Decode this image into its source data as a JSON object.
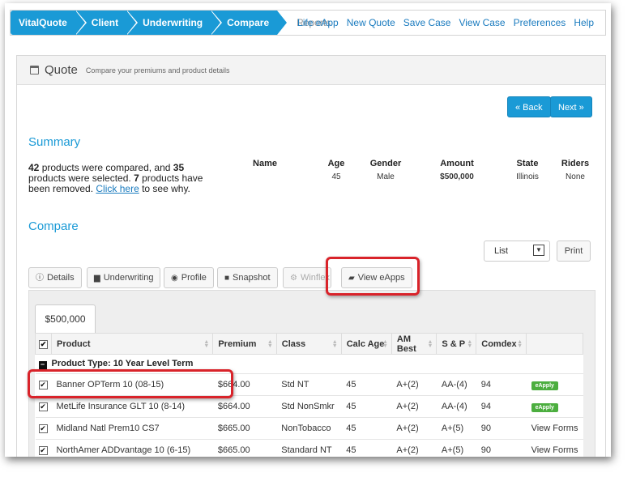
{
  "nav": {
    "crumbs": [
      "VitalQuote",
      "Client",
      "Underwriting",
      "Compare",
      "Reports"
    ],
    "menu": [
      "Life eApp",
      "New Quote",
      "Save Case",
      "View Case",
      "Preferences",
      "Help"
    ]
  },
  "quote": {
    "title": "Quote",
    "subtitle": "Compare your premiums and product details",
    "back_label": "« Back",
    "next_label": "Next »"
  },
  "summary": {
    "heading": "Summary",
    "compared": "42",
    "selected": "35",
    "removed": "7",
    "text_1": " products were compared, and ",
    "text_2": " products were selected. ",
    "text_3": " products have been removed. ",
    "click_here": "Click here",
    "text_4": " to see why.",
    "stats": [
      {
        "label": "Name",
        "value": ""
      },
      {
        "label": "Age",
        "value": "45"
      },
      {
        "label": "Gender",
        "value": "Male"
      },
      {
        "label": "Amount",
        "value": "$500,000"
      },
      {
        "label": "State",
        "value": "Illinois"
      },
      {
        "label": "Riders",
        "value": "None"
      }
    ]
  },
  "compare": {
    "heading": "Compare",
    "view_select": "List",
    "print_label": "Print",
    "tabs": [
      "Details",
      "Underwriting",
      "Profile",
      "Snapshot",
      "Winflex",
      "View eApps"
    ],
    "amount_tab": "$500,000",
    "columns": [
      "Product",
      "Premium",
      "Class",
      "Calc Age",
      "AM Best",
      "S & P",
      "Comdex"
    ],
    "group_label": "Product Type: 10 Year Level Term",
    "rows": [
      {
        "product": "Banner OPTerm 10 (08-15)",
        "premium": "$664.00",
        "class": "Std NT",
        "calc_age": "45",
        "am_best": "A+(2)",
        "sp": "AA-(4)",
        "comdex": "94",
        "action": "eApply"
      },
      {
        "product": "MetLife Insurance GLT 10 (8-14)",
        "premium": "$664.00",
        "class": "Std NonSmkr",
        "calc_age": "45",
        "am_best": "A+(2)",
        "sp": "AA-(4)",
        "comdex": "94",
        "action": "eApply"
      },
      {
        "product": "Midland Natl Prem10 CS7",
        "premium": "$665.00",
        "class": "NonTobacco",
        "calc_age": "45",
        "am_best": "A+(2)",
        "sp": "A+(5)",
        "comdex": "90",
        "action": "View Forms"
      },
      {
        "product": "NorthAmer ADDvantage 10 (6-15)",
        "premium": "$665.00",
        "class": "Standard NT",
        "calc_age": "45",
        "am_best": "A+(2)",
        "sp": "A+(5)",
        "comdex": "90",
        "action": "View Forms"
      }
    ]
  },
  "colors": {
    "accent": "#1a9ad6",
    "highlight": "#d9232a",
    "eapply": "#4cae3f"
  }
}
